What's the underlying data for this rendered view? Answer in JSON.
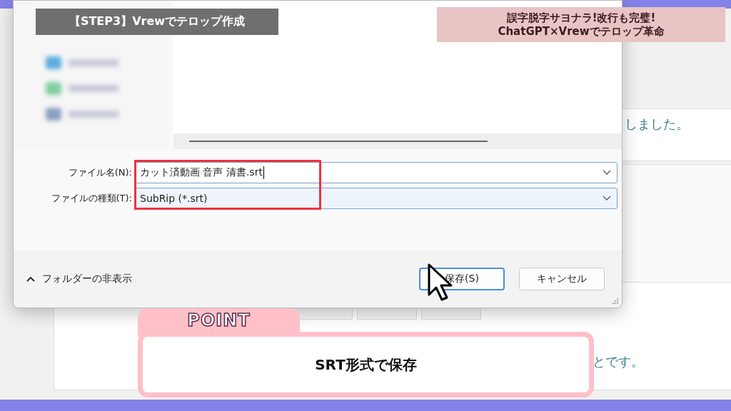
{
  "header_tags": {
    "step": "【STEP3】Vrewでテロップ作成",
    "title_lines": [
      "誤字脱字サヨナラ!改行も完璧!",
      "ChatGPT×Vrewでテロップ革命"
    ]
  },
  "background_app": {
    "texts": [
      "しました。",
      "とです。"
    ]
  },
  "save_dialog": {
    "fields": [
      {
        "label": "ファイル名(N):",
        "value": "カット済動画 音声 清書.srt",
        "kind": "input"
      },
      {
        "label": "ファイルの種類(T):",
        "value": "SubRip (*.srt)",
        "kind": "select"
      }
    ],
    "folder_toggle": "フォルダーの非表示",
    "buttons": [
      {
        "label": "保存(S)",
        "kind": "primary"
      },
      {
        "label": "キャンセル",
        "kind": "secondary"
      }
    ]
  },
  "point": {
    "badge": "POINT",
    "text": "SRT形式で保存"
  }
}
